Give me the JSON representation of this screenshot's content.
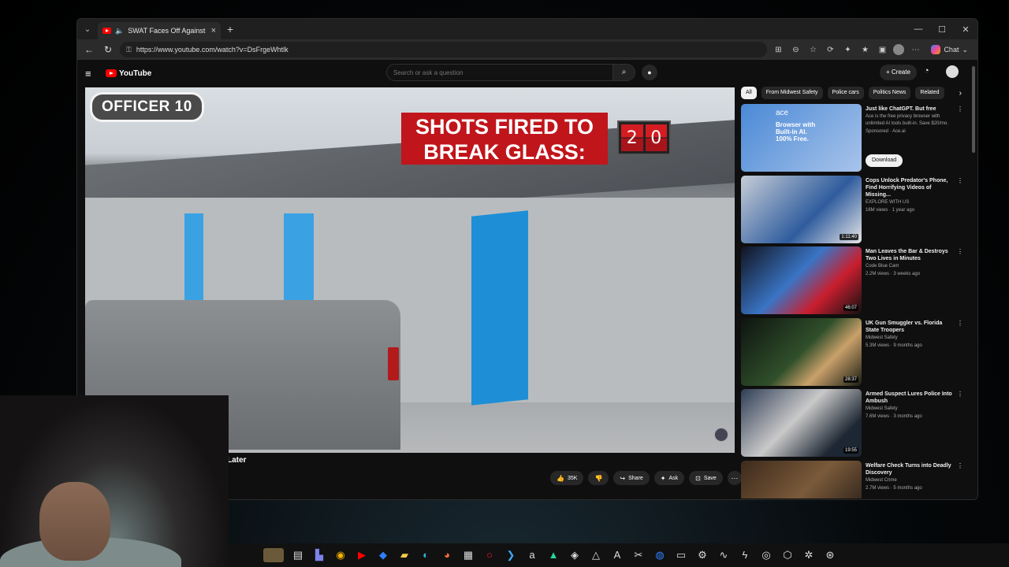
{
  "browser": {
    "tab_title": "SWAT Faces Off Against Killer",
    "url": "https://www.youtube.com/watch?v=DsFrgeWhtlk",
    "chat_label": "Chat"
  },
  "youtube": {
    "logo_text": "YouTube",
    "search_placeholder": "Search or ask a question",
    "create_label": "Create",
    "video": {
      "officer_label": "OFFICER 10",
      "shots_banner": "SHOTS FIRED TO BREAK GLASS:",
      "counter_digits": [
        "2",
        "0"
      ],
      "title_tail": "Later",
      "actions": {
        "likes": "35K",
        "share": "Share",
        "ask": "Ask",
        "save": "Save"
      }
    },
    "chips": [
      "All",
      "From Midwest Safety",
      "Police cars",
      "Politics News",
      "Related"
    ],
    "recommendations": [
      {
        "title": "Just like ChatGPT. But free",
        "desc": "Ace is the free privacy browser with unlimited AI tools built-in. Save $20/mo.",
        "sponsor": "Sponsored · Ace.ai",
        "button": "Download",
        "ad_brand": "ace",
        "ad_text": "Browser with Built-in AI. 100% Free."
      },
      {
        "title": "Cops Unlock Predator's Phone, Find Horrifying Videos of Missing...",
        "channel": "EXPLORE WITH US",
        "meta": "16M views · 1 year ago",
        "duration": "1:11:40"
      },
      {
        "title": "Man Leaves the Bar & Destroys Two Lives in Minutes",
        "channel": "Code Blue Cam",
        "meta": "2.2M views · 3 weeks ago",
        "duration": "46:07"
      },
      {
        "title": "UK Gun Smuggler vs. Florida State Troopers",
        "channel": "Midwest Safety",
        "meta": "5.3M views · 9 months ago",
        "duration": "28:37"
      },
      {
        "title": "Armed Suspect Lures Police Into Ambush",
        "channel": "Midwest Safety",
        "meta": "7.6M views · 3 months ago",
        "duration": "19:55"
      },
      {
        "title": "Welfare Check Turns into Deadly Discovery",
        "channel": "Midwest Crime",
        "meta": "2.7M views · 5 months ago",
        "duration": ""
      }
    ]
  },
  "icons": {
    "back": "←",
    "reload": "↻",
    "search": "⌕",
    "mic": "🎙",
    "bell": "🔔",
    "menu": "≡",
    "kebab": "⋮"
  }
}
